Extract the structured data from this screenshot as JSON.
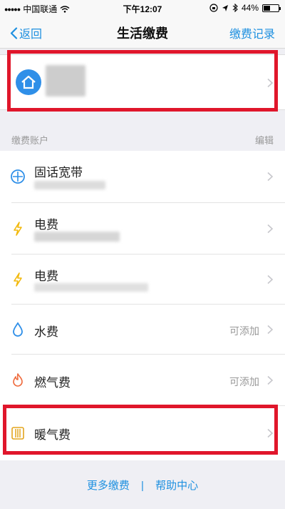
{
  "status_bar": {
    "carrier": "中国联通",
    "time": "下午12:07",
    "battery": "44%",
    "battery_level": 0.44
  },
  "nav": {
    "back_label": "返回",
    "title": "生活缴费",
    "history_label": "缴费记录"
  },
  "section": {
    "label": "缴费账户",
    "edit_label": "编辑"
  },
  "items": [
    {
      "name": "固话宽带",
      "icon": "phone-broadband-icon",
      "status": ""
    },
    {
      "name": "电费",
      "icon": "lightning-icon",
      "status": ""
    },
    {
      "name": "电费",
      "icon": "lightning-icon",
      "status": ""
    },
    {
      "name": "水费",
      "icon": "water-drop-icon",
      "status": "可添加"
    },
    {
      "name": "燃气费",
      "icon": "flame-icon",
      "status": "可添加"
    },
    {
      "name": "暖气费",
      "icon": "radiator-icon",
      "status": ""
    }
  ],
  "footer": {
    "more_label": "更多缴费",
    "divider": "|",
    "help_label": "帮助中心"
  },
  "colors": {
    "accent": "#1e90e0",
    "highlight": "#e0162b",
    "electric": "#f2b90c",
    "water": "#2f8fe8",
    "gas": "#ef6a3c",
    "heating": "#e3a51e"
  }
}
